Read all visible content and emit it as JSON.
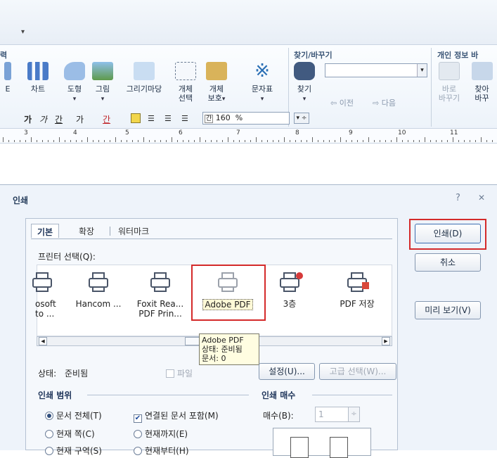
{
  "toolbar": {
    "dropdown_arrow": "▾",
    "groups": {
      "find_replace": "찾기/바꾸기",
      "personal_info": "개인 정보 바",
      "left_cut": "력"
    },
    "buttons": {
      "chart": "차트",
      "shape": "도형",
      "picture": "그림",
      "drawing": "그리기마당",
      "object_select_1": "개체",
      "object_select_2": "선택",
      "object_protect_1": "개체",
      "object_protect_2": "보호",
      "char_map": "문자표",
      "find": "찾기",
      "prev": "이전",
      "next": "다음",
      "replace_1": "바로",
      "replace_2": "바꾸기",
      "find_replace_1": "찾아",
      "find_replace_2": "바꾸",
      "left_cut": "E"
    },
    "format": {
      "ga1": "가",
      "ga2": "가",
      "ga3": "간",
      "ga4": "가",
      "ga5": "간",
      "spacing_icon_text": "간",
      "percent_value": "160",
      "percent_sign": "%"
    }
  },
  "ruler": {
    "labels": [
      "3",
      "4",
      "5",
      "6",
      "7",
      "8",
      "9",
      "10",
      "11"
    ]
  },
  "dialog": {
    "title": "인쇄",
    "help": "?",
    "close": "✕",
    "tabs": [
      "기본",
      "확장",
      "워터마크"
    ],
    "printer_select_label": "프린터 선택(Q):",
    "printers": [
      {
        "name": "osoft",
        "name2": "to ..."
      },
      {
        "name": "Hancom ...",
        "name2": ""
      },
      {
        "name": "Foxit Rea...",
        "name2": "PDF Prin..."
      },
      {
        "name": "Adobe PDF",
        "name2": ""
      },
      {
        "name": "3층",
        "name2": ""
      },
      {
        "name": "PDF 저장",
        "name2": ""
      }
    ],
    "tooltip": [
      "Adobe PDF",
      "상태: 준비됨",
      "문서: 0"
    ],
    "status_label": "상태:",
    "status_value": "준비됨",
    "file_label": "파일",
    "settings_button": "설정(U)...",
    "advanced_button": "고급 선택(W)...",
    "print_range_title": "인쇄 범위",
    "range_options": {
      "whole_doc": "문서 전체(T)",
      "include_linked": "연결된 문서 포함(M)",
      "current_page": "현재 쪽(C)",
      "up_to_current": "현재까지(E)",
      "current_section": "현재 구역(S)",
      "from_current": "현재부터(H)"
    },
    "copies_title": "인쇄 매수",
    "copies_label": "매수(B):",
    "copies_value": "1",
    "print_button": "인쇄(D)",
    "cancel_button": "취소",
    "preview_button": "미리 보기(V)"
  },
  "colors": {
    "highlight": "#d42a2a",
    "ribbon_group_title": "#3b5576"
  }
}
